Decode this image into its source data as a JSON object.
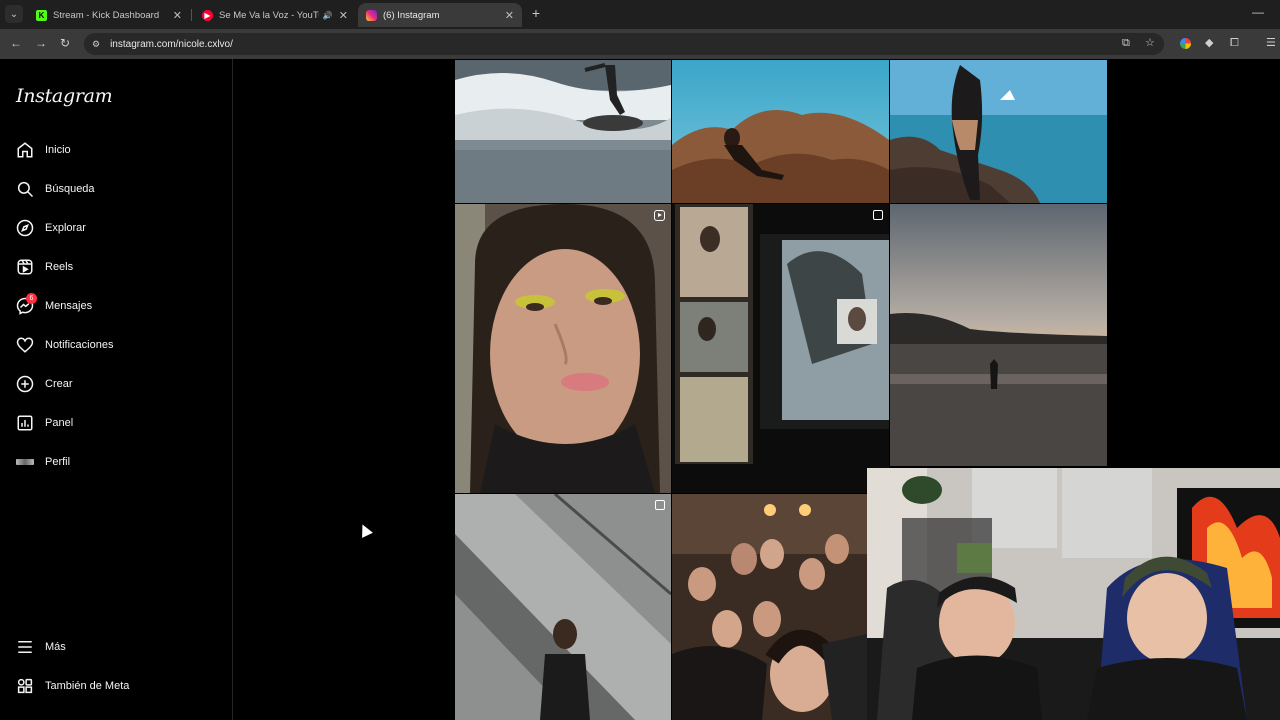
{
  "browser": {
    "tabs": [
      {
        "title": "Stream - Kick Dashboard",
        "favicon": "kick-icon",
        "active": false
      },
      {
        "title": "Se Me Va la Voz - YouTube",
        "favicon": "youtube-icon",
        "active": false,
        "audio": true
      },
      {
        "title": "(6) Instagram",
        "favicon": "instagram-icon",
        "active": true
      }
    ],
    "url": "instagram.com/nicole.cxlvo/"
  },
  "instagram": {
    "logo": "Instagram",
    "nav": [
      {
        "label": "Inicio",
        "icon": "home-icon"
      },
      {
        "label": "Búsqueda",
        "icon": "search-icon"
      },
      {
        "label": "Explorar",
        "icon": "compass-icon"
      },
      {
        "label": "Reels",
        "icon": "reels-icon"
      },
      {
        "label": "Mensajes",
        "icon": "messenger-icon",
        "badge": "6"
      },
      {
        "label": "Notificaciones",
        "icon": "heart-icon"
      },
      {
        "label": "Crear",
        "icon": "plus-square-icon"
      },
      {
        "label": "Panel",
        "icon": "chart-icon"
      },
      {
        "label": "Perfil",
        "icon": "profile-avatar"
      }
    ],
    "bottom_nav": [
      {
        "label": "Más",
        "icon": "menu-icon"
      },
      {
        "label": "También de Meta",
        "icon": "meta-apps-icon"
      }
    ],
    "posts": [
      {
        "id": "surf",
        "badge": null
      },
      {
        "id": "rocks-sitting",
        "badge": null
      },
      {
        "id": "rocks-standing",
        "badge": null
      },
      {
        "id": "selfie",
        "badge": "reel"
      },
      {
        "id": "film-strip",
        "badge": "multi"
      },
      {
        "id": "sunset-beach",
        "badge": null
      },
      {
        "id": "wall-portrait",
        "badge": "multi"
      },
      {
        "id": "group-photo",
        "badge": null
      }
    ]
  },
  "colors": {
    "background": "#000000",
    "text": "#f5f5f5",
    "badge": "#ff3040",
    "chrome": "#3a3a3a"
  }
}
